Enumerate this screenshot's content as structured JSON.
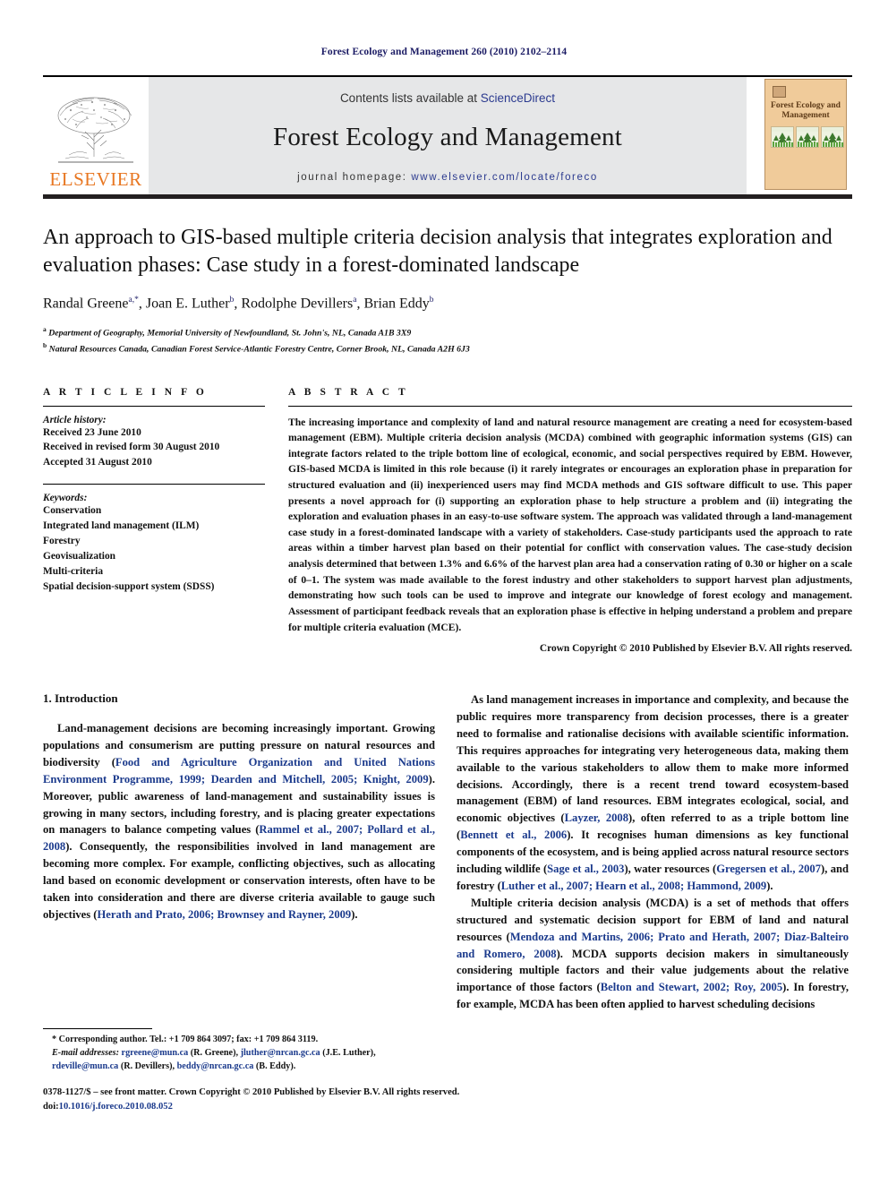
{
  "running_head": "Forest Ecology and Management 260 (2010) 2102–2114",
  "masthead": {
    "contents_prefix": "Contents lists available at ",
    "sciencedirect": "ScienceDirect",
    "journal_title": "Forest Ecology and Management",
    "homepage_prefix": "journal homepage:",
    "homepage_url": "www.elsevier.com/locate/foreco",
    "publisher_wordmark": "ELSEVIER",
    "cover_title": "Forest Ecology and Management",
    "accent_orange": "#e87722",
    "band_grey": "#e6e7e8",
    "link_blue": "#2b3a8f",
    "cover_tan": "#f0cb9a"
  },
  "article": {
    "title": "An approach to GIS-based multiple criteria decision analysis that integrates exploration and evaluation phases: Case study in a forest-dominated landscape",
    "authors_html": "Randal Greene<sup>a,*</sup>, Joan E. Luther<sup>b</sup>, Rodolphe Devillers<sup>a</sup>, Brian Eddy<sup>b</sup>",
    "affiliation_a": "Department of Geography, Memorial University of Newfoundland, St. John's, NL, Canada A1B 3X9",
    "affiliation_b": "Natural Resources Canada, Canadian Forest Service-Atlantic Forestry Centre, Corner Brook, NL, Canada A2H 6J3"
  },
  "article_info": {
    "heading": "A R T I C L E   I N F O",
    "history_label": "Article history:",
    "history": [
      "Received 23 June 2010",
      "Received in revised form 30 August 2010",
      "Accepted 31 August 2010"
    ],
    "keywords_label": "Keywords:",
    "keywords": [
      "Conservation",
      "Integrated land management (ILM)",
      "Forestry",
      "Geovisualization",
      "Multi-criteria",
      "Spatial decision-support system (SDSS)"
    ]
  },
  "abstract": {
    "heading": "A B S T R A C T",
    "text": "The increasing importance and complexity of land and natural resource management are creating a need for ecosystem-based management (EBM). Multiple criteria decision analysis (MCDA) combined with geographic information systems (GIS) can integrate factors related to the triple bottom line of ecological, economic, and social perspectives required by EBM. However, GIS-based MCDA is limited in this role because (i) it rarely integrates or encourages an exploration phase in preparation for structured evaluation and (ii) inexperienced users may find MCDA methods and GIS software difficult to use. This paper presents a novel approach for (i) supporting an exploration phase to help structure a problem and (ii) integrating the exploration and evaluation phases in an easy-to-use software system. The approach was validated through a land-management case study in a forest-dominated landscape with a variety of stakeholders. Case-study participants used the approach to rate areas within a timber harvest plan based on their potential for conflict with conservation values. The case-study decision analysis determined that between 1.3% and 6.6% of the harvest plan area had a conservation rating of 0.30 or higher on a scale of 0–1. The system was made available to the forest industry and other stakeholders to support harvest plan adjustments, demonstrating how such tools can be used to improve and integrate our knowledge of forest ecology and management. Assessment of participant feedback reveals that an exploration phase is effective in helping understand a problem and prepare for multiple criteria evaluation (MCE).",
    "copyright": "Crown Copyright © 2010 Published by Elsevier B.V. All rights reserved."
  },
  "body": {
    "section_number_title": "1. Introduction",
    "left_paragraph_1_html": "Land-management decisions are becoming increasingly important. Growing populations and consumerism are putting pressure on natural resources and biodiversity (<span class=\"cite\">Food and Agriculture Organization and United Nations Environment Programme, 1999; Dearden and Mitchell, 2005; Knight, 2009</span>). Moreover, public awareness of land-management and sustainability issues is growing in many sectors, including forestry, and is placing greater expectations on managers to balance competing values (<span class=\"cite\">Rammel et al., 2007; Pollard et al., 2008</span>). Consequently, the responsibilities involved in land management are becoming more complex. For example, conflicting objectives, such as allocating land based on economic development or conservation interests, often have to be taken into consideration and there are diverse criteria available to gauge such objectives (<span class=\"cite\">Herath and Prato, 2006; Brownsey and Rayner, 2009</span>).",
    "right_paragraph_1_html": "As land management increases in importance and complexity, and because the public requires more transparency from decision processes, there is a greater need to formalise and rationalise decisions with available scientific information. This requires approaches for integrating very heterogeneous data, making them available to the various stakeholders to allow them to make more informed decisions. Accordingly, there is a recent trend toward ecosystem-based management (EBM) of land resources. EBM integrates ecological, social, and economic objectives (<span class=\"cite\">Layzer, 2008</span>), often referred to as a triple bottom line (<span class=\"cite\">Bennett et al., 2006</span>). It recognises human dimensions as key functional components of the ecosystem, and is being applied across natural resource sectors including wildlife (<span class=\"cite\">Sage et al., 2003</span>), water resources (<span class=\"cite\">Gregersen et al., 2007</span>), and forestry (<span class=\"cite\">Luther et al., 2007; Hearn et al., 2008; Hammond, 2009</span>).",
    "right_paragraph_2_html": "Multiple criteria decision analysis (MCDA) is a set of methods that offers structured and systematic decision support for EBM of land and natural resources (<span class=\"cite\">Mendoza and Martins, 2006; Prato and Herath, 2007; Diaz-Balteiro and Romero, 2008</span>). MCDA supports decision makers in simultaneously considering multiple factors and their value judgements about the relative importance of those factors (<span class=\"cite\">Belton and Stewart, 2002; Roy, 2005</span>). In forestry, for example, MCDA has been often applied to harvest scheduling decisions"
  },
  "footnotes": {
    "corresponding_html": "* Corresponding author. Tel.: +1 709 864 3097; fax: +1 709 864 3119.",
    "emails_html": "<span class=\"em\">E-mail addresses:</span> <span class=\"mail\">rgreene@mun.ca</span> (R. Greene), <span class=\"mail\">jluther@nrcan.gc.ca</span> (J.E. Luther), <span class=\"mail\">rdeville@mun.ca</span> (R. Devillers), <span class=\"mail\">beddy@nrcan.gc.ca</span> (B. Eddy)."
  },
  "imprint": {
    "front_matter": "0378-1127/$ – see front matter. Crown Copyright © 2010 Published by Elsevier B.V. All rights reserved.",
    "doi_label": "doi:",
    "doi_value": "10.1016/j.foreco.2010.08.052"
  }
}
